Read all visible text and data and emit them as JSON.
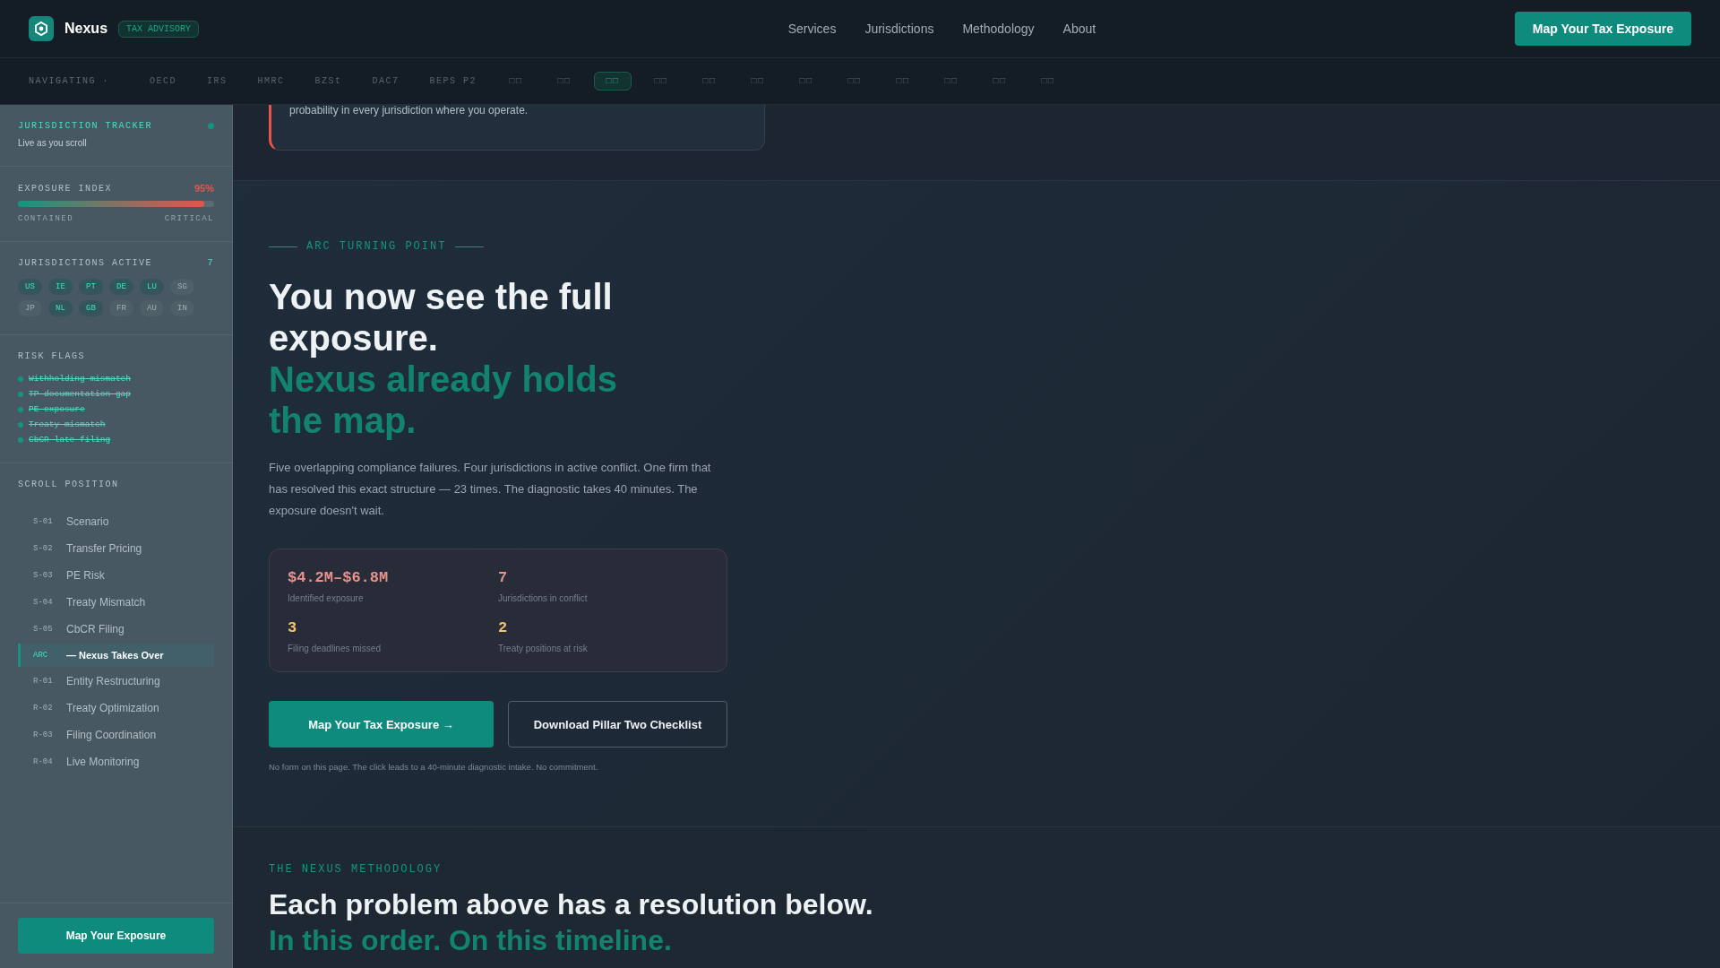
{
  "header": {
    "brand": "Nexus",
    "badge": "TAX ADVISORY",
    "links": [
      "Services",
      "Jurisdictions",
      "Methodology",
      "About"
    ],
    "cta": "Map Your Tax Exposure"
  },
  "strip": {
    "label": "NAVIGATING ·",
    "items": [
      {
        "label": "OECD",
        "selected": false
      },
      {
        "label": "IRS",
        "selected": false
      },
      {
        "label": "HMRC",
        "selected": false
      },
      {
        "label": "BZSt",
        "selected": false
      },
      {
        "label": "DAC7",
        "selected": false
      },
      {
        "label": "BEPS P2",
        "selected": false
      },
      {
        "label": "□□",
        "selected": false
      },
      {
        "label": "□□",
        "selected": false
      },
      {
        "label": "□□",
        "selected": true
      },
      {
        "label": "□□",
        "selected": false
      },
      {
        "label": "□□",
        "selected": false
      },
      {
        "label": "□□",
        "selected": false
      },
      {
        "label": "□□",
        "selected": false
      },
      {
        "label": "□□",
        "selected": false
      },
      {
        "label": "□□",
        "selected": false
      },
      {
        "label": "□□",
        "selected": false
      },
      {
        "label": "□□",
        "selected": false
      },
      {
        "label": "□□",
        "selected": false
      }
    ]
  },
  "sidebar": {
    "tracker": {
      "title": "JURISDICTION TRACKER",
      "subtitle": "Live as you scroll",
      "live": true
    },
    "exposure": {
      "title": "EXPOSURE INDEX",
      "value": "95%",
      "level": 0.95,
      "low": "CONTAINED",
      "high": "CRITICAL"
    },
    "jurisdictions": {
      "title": "JURISDICTIONS ACTIVE",
      "count": "7",
      "chips": [
        {
          "code": "US",
          "active": true
        },
        {
          "code": "IE",
          "active": true
        },
        {
          "code": "PT",
          "active": true
        },
        {
          "code": "DE",
          "active": true
        },
        {
          "code": "LU",
          "active": true
        },
        {
          "code": "SG",
          "active": false
        },
        {
          "code": "JP",
          "active": false
        },
        {
          "code": "NL",
          "active": true
        },
        {
          "code": "GB",
          "active": true
        },
        {
          "code": "FR",
          "active": false
        },
        {
          "code": "AU",
          "active": false
        },
        {
          "code": "IN",
          "active": false
        }
      ]
    },
    "risk_flags": {
      "title": "RISK FLAGS",
      "items": [
        {
          "label": "Withholding mismatch",
          "resolved": true
        },
        {
          "label": "TP documentation gap",
          "resolved": true
        },
        {
          "label": "PE exposure",
          "resolved": true
        },
        {
          "label": "Treaty mismatch",
          "resolved": true
        },
        {
          "label": "CbCR late filing",
          "resolved": true
        }
      ]
    },
    "scroll_position": {
      "title": "SCROLL POSITION",
      "items": [
        {
          "code": "S-01",
          "label": "Scenario",
          "selected": false
        },
        {
          "code": "S-02",
          "label": "Transfer Pricing",
          "selected": false
        },
        {
          "code": "S-03",
          "label": "PE Risk",
          "selected": false
        },
        {
          "code": "S-04",
          "label": "Treaty Mismatch",
          "selected": false
        },
        {
          "code": "S-05",
          "label": "CbCR Filing",
          "selected": false
        },
        {
          "code": "ARC",
          "label": "— Nexus Takes Over",
          "selected": true
        },
        {
          "code": "R-01",
          "label": "Entity Restructuring",
          "selected": false
        },
        {
          "code": "R-02",
          "label": "Treaty Optimization",
          "selected": false
        },
        {
          "code": "R-03",
          "label": "Filing Coordination",
          "selected": false
        },
        {
          "code": "R-04",
          "label": "Live Monitoring",
          "selected": false
        }
      ]
    },
    "cta": "Map Your Exposure"
  },
  "main": {
    "previous_card": {
      "text": "probability in every jurisdiction where you operate."
    },
    "turning_point": {
      "eyebrow": "ARC TURNING POINT",
      "headline": "You now see the full exposure.",
      "headline_accent": "Nexus already holds the map.",
      "body": "Five overlapping compliance failures. Four jurisdictions in active conflict. One firm that has resolved this exact structure — 23 times. The diagnostic takes 40 minutes. The exposure doesn't wait.",
      "stats": [
        {
          "value": "$4.2M–$6.8M",
          "label": "Identified exposure",
          "color": "#e8928c"
        },
        {
          "value": "7",
          "label": "Jurisdictions in conflict",
          "color": "#e8928c"
        },
        {
          "value": "3",
          "label": "Filing deadlines missed",
          "color": "#f2c56b"
        },
        {
          "value": "2",
          "label": "Treaty positions at risk",
          "color": "#f2c56b"
        }
      ],
      "primary": "Map Your Tax Exposure →",
      "secondary": "Download Pillar Two Checklist",
      "note": "No form on this page. The click leads to a 40-minute diagnostic intake. No commitment."
    },
    "methodology": {
      "eyebrow": "THE NEXUS METHODOLOGY",
      "headline": "Each problem above has a resolution below.",
      "headline_accent": "In this order. On this timeline."
    }
  }
}
